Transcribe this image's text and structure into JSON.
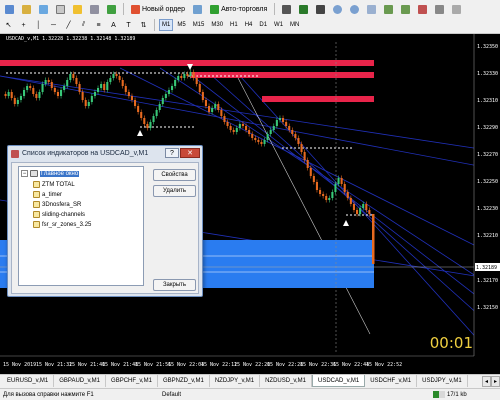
{
  "toolbar": {
    "new_order_label": "Новый ордер",
    "autotrading_label": "Авто-торговля",
    "timeframes": [
      "M1",
      "M5",
      "M15",
      "M30",
      "H1",
      "H4",
      "D1",
      "W1",
      "MN"
    ],
    "active_timeframe": "M1"
  },
  "chart": {
    "title": "USDCAD_v,M1  1.32228 1.32238 1.32148 1.32189",
    "price_labels": [
      "1.32350",
      "1.32330",
      "1.32310",
      "1.32290",
      "1.32270",
      "1.32250",
      "1.32230",
      "1.32210",
      "1.32189",
      "1.32170",
      "1.32150"
    ],
    "current_price": "1.32189",
    "time_labels": [
      "15 Nov 2019",
      "15 Nov 21:32",
      "15 Nov 21:40",
      "15 Nov 21:48",
      "15 Nov 21:56",
      "15 Nov 22:04",
      "15 Nov 22:12",
      "15 Nov 22:20",
      "15 Nov 22:28",
      "15 Nov 22:36",
      "15 Nov 22:44",
      "15 Nov 22:52"
    ],
    "countdown": "00:01",
    "colors": {
      "background": "#000000",
      "bull": "#38c878",
      "bear": "#e86a20",
      "zone_red": "#e8244a",
      "zone_blue": "#2a7cf0",
      "channel": "#2030b8"
    }
  },
  "dialog": {
    "title": "Список индикаторов на USDCAD_v,M1",
    "help_label": "?",
    "close_label": "✕",
    "root_label": "Главное окно",
    "indicators": [
      "ZTM TOTAL",
      "a_timer",
      "3Dnosfera_SR",
      "sliding-channels",
      "fsr_sr_zones_3.25"
    ],
    "properties_button": "Свойства",
    "delete_button": "Удалить",
    "close_button": "Закрыть"
  },
  "tabs": {
    "items": [
      "EURUSD_v,M1",
      "GBPAUD_v,M1",
      "GBPCHF_v,M1",
      "GBPNZD_v,M1",
      "NZDJPY_v,M1",
      "NZDUSD_v,M1",
      "USDCAD_v,M1",
      "USDCHF_v,M1",
      "USDJPY_v,M1"
    ],
    "active_index": 6
  },
  "status": {
    "help_text": "Для вызова справки нажмите F1",
    "profile": "Default",
    "traffic": "17/1 kb"
  }
}
